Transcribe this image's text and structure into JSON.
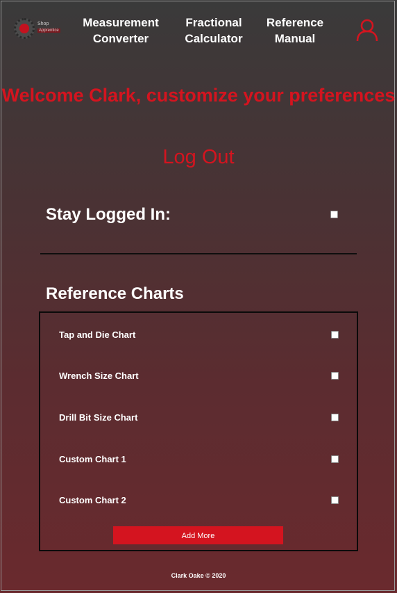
{
  "nav": {
    "logo": {
      "top": "Shop",
      "bottom": "Apprentice"
    },
    "links": [
      {
        "line1": "Measurement",
        "line2": "Converter"
      },
      {
        "line1": "Fractional",
        "line2": "Calculator"
      },
      {
        "line1": "Reference",
        "line2": "Manual"
      }
    ],
    "user_icon": "user-icon"
  },
  "welcome": "Welcome Clark, customize your preferences",
  "logout_label": "Log Out",
  "stay_logged_in": {
    "label": "Stay Logged In:",
    "checked": false
  },
  "reference_charts": {
    "heading": "Reference Charts",
    "items": [
      {
        "label": "Tap and Die Chart",
        "checked": false
      },
      {
        "label": "Wrench Size Chart",
        "checked": false
      },
      {
        "label": "Drill Bit Size Chart",
        "checked": false
      },
      {
        "label": "Custom Chart 1",
        "checked": false
      },
      {
        "label": "Custom Chart 2",
        "checked": false
      }
    ],
    "add_more_label": "Add More"
  },
  "footer": "Clark Oake © 2020",
  "colors": {
    "accent": "#d4141f",
    "text": "#ffffff"
  }
}
